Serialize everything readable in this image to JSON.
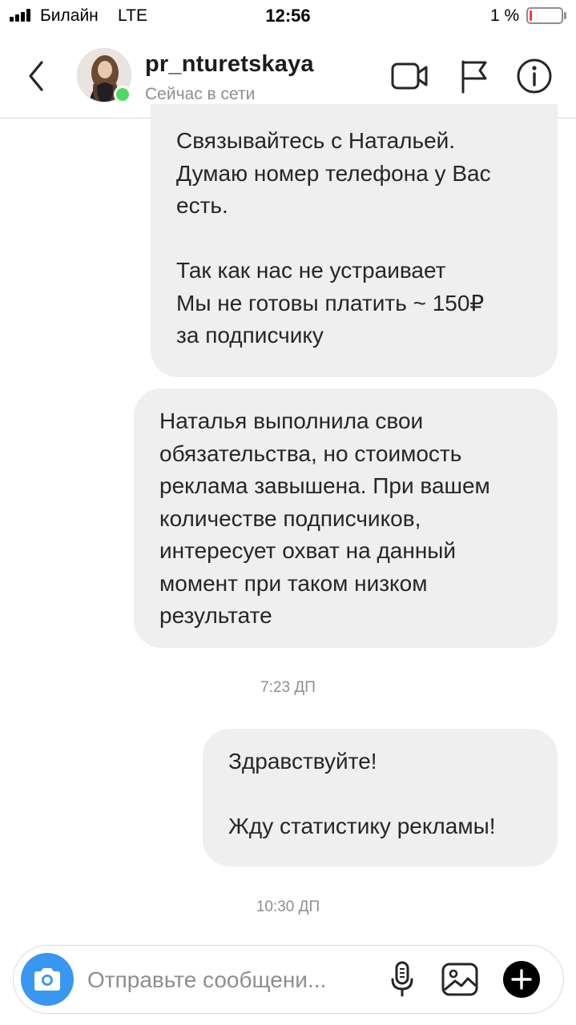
{
  "status_bar": {
    "carrier": "Билайн",
    "network": "LTE",
    "time": "12:56",
    "battery_percent": "1 %",
    "battery_level": 0.01,
    "low_battery_color": "#ff3b30"
  },
  "header": {
    "username": "pr_nturetskaya",
    "presence": "Сейчас в сети",
    "online_color": "#4cd964",
    "icons": [
      "back-chevron-icon",
      "video-camera-icon",
      "flag-icon",
      "info-icon"
    ]
  },
  "messages": [
    {
      "lines": [
        "Связывайтесь с Натальей.",
        "Думаю номер телефона у Вас",
        "есть.",
        "",
        "Так как нас не устраивает",
        "Мы не готовы платить ~ 150₽",
        "за подписчику"
      ]
    },
    {
      "lines": [
        "Наталья выполнила свои",
        "обязательства, но стоимость",
        "реклама завышена. При вашем",
        "количестве подписчиков,",
        "интересует охват на данный",
        "момент при таком низком",
        "результате"
      ]
    },
    {
      "lines": [
        "Здравствуйте!",
        "",
        "Жду статистику рекламы!"
      ]
    }
  ],
  "timestamps": [
    "7:23 ДП",
    "10:30 ДП"
  ],
  "composer": {
    "placeholder": "Отправьте сообщени...",
    "camera_color": "#3897f0",
    "icons": [
      "camera-icon",
      "microphone-icon",
      "gallery-icon",
      "plus-icon"
    ]
  },
  "colors": {
    "bubble_bg": "#efefef",
    "text": "#262626",
    "secondary_text": "#8e8e93"
  }
}
